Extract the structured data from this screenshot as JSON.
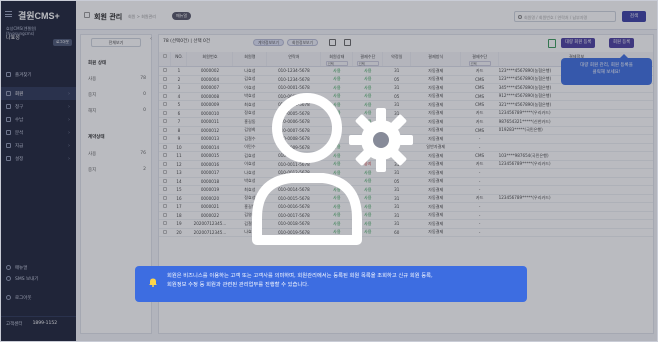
{
  "sidebar": {
    "logo": "결원CMS+",
    "user": {
      "line1": "효성CMS(엔젤원)",
      "line2": "(hyosungcms)",
      "name": "나효성"
    },
    "logout_label": "로그아웃",
    "nav": [
      {
        "label": "즐겨찾기",
        "icon": "star-icon"
      },
      {
        "label": "회원",
        "icon": "user-icon",
        "active": true
      },
      {
        "label": "청구",
        "icon": "bill-icon"
      },
      {
        "label": "수납",
        "icon": "payment-icon"
      },
      {
        "label": "분석",
        "icon": "chart-icon"
      },
      {
        "label": "지급",
        "icon": "send-icon"
      },
      {
        "label": "설정",
        "icon": "gear-icon"
      }
    ],
    "bottom": [
      {
        "label": "매뉴얼",
        "icon": "book-icon"
      },
      {
        "label": "SMS 보내기",
        "icon": "sms-icon"
      },
      {
        "label": "로그아웃",
        "icon": "logout-icon"
      }
    ],
    "contact": {
      "label": "고객센터",
      "number": "1899-1152"
    }
  },
  "topbar": {
    "title": "회원 관리",
    "breadcrumb": "회원 > 회원관리",
    "badge": "매뉴얼",
    "search_placeholder": "회원명 / 회원번호 / 연락처 / 납부자명",
    "search_button": "검색"
  },
  "filter": {
    "button": "전체보기",
    "sections": [
      {
        "title": "회원 상태",
        "rows": [
          {
            "label": "사용",
            "count": "78"
          },
          {
            "label": "중지",
            "count": "0"
          },
          {
            "label": "해지",
            "count": "0"
          }
        ]
      },
      {
        "title": "계약상태",
        "rows": [
          {
            "label": "사용",
            "count": "76"
          },
          {
            "label": "중지",
            "count": "2"
          }
        ]
      }
    ]
  },
  "grid": {
    "total": "78",
    "selected": "선택 0건",
    "count_text": "78 (선택0건) | 선택 0건",
    "chips": [
      "계약정보보기",
      "회원정보보기"
    ],
    "register_bulk": "대량 회원 등록",
    "register_one": "회원 등록",
    "columns": [
      "",
      "NO.",
      "회원번호",
      "회원명",
      "연락처",
      "회원상태",
      "결제수단",
      "약정일",
      "결제방식",
      "결제수단",
      "결제정보"
    ],
    "sub_labels": {
      "c5": "선택",
      "c6": "선택",
      "c9": "선택"
    },
    "rows": [
      [
        "1",
        "0000002",
        "나효성",
        "010-1234-5678",
        "사용",
        "사용",
        "31",
        "자동결제",
        "카드",
        "123****4567890(농협은행)"
      ],
      [
        "2",
        "0000004",
        "김효성",
        "010-1234-5678",
        "사용",
        "사용",
        "05",
        "자동결제",
        "CMS",
        "123****4567890(농협은행)"
      ],
      [
        "3",
        "0000007",
        "이효성",
        "010-0001-5678",
        "사용",
        "사용",
        "31",
        "자동결제",
        "CMS",
        "345****4567890(농협은행)"
      ],
      [
        "4",
        "0000008",
        "박효성",
        "010-0002-5678",
        "사용",
        "사용",
        "05",
        "자동결제",
        "CMS",
        "912****4567890(농협은행)"
      ],
      [
        "5",
        "0000009",
        "최효성",
        "010-0004-5678",
        "사용",
        "사용",
        "31",
        "자동결제",
        "CMS",
        "321****4567890(농협은행)"
      ],
      [
        "6",
        "0000010",
        "정효성",
        "010-0005-5678",
        "사용",
        "사용",
        "31",
        "자동결제",
        "카드",
        "123456789*****(우리카드)"
      ],
      [
        "7",
        "0000011",
        "홍길동",
        "010-0006-5678",
        "사용",
        "사용",
        "31",
        "자동결제",
        "카드",
        "987654321*****(신한카드)"
      ],
      [
        "8",
        "0000012",
        "김영희",
        "010-0007-5678",
        "사용",
        "사용",
        "31",
        "자동결제",
        "CMS",
        "019283*****(국민은행)"
      ],
      [
        "9",
        "0000013",
        "김철수",
        "010-0008-5678",
        "사용",
        "중지",
        "31",
        "자동결제",
        "-",
        ""
      ],
      [
        "10",
        "0000014",
        "이민수",
        "010-0009-5678",
        "사용",
        "사용",
        "31",
        "일반자결제",
        "-",
        ""
      ],
      [
        "11",
        "0000015",
        "김효성",
        "010-0010-5678",
        "사용",
        "사용",
        "05",
        "자동결제",
        "CMS",
        "103****987654(국민은행)"
      ],
      [
        "12",
        "0000016",
        "이효성",
        "010-0011-5678",
        "사용",
        "중지",
        "31",
        "자동결제",
        "카드",
        "123456789*****(우리카드)"
      ],
      [
        "13",
        "0000017",
        "나효성",
        "010-0012-5678",
        "사용",
        "사용",
        "31",
        "자동결제",
        "-",
        ""
      ],
      [
        "14",
        "0000018",
        "박효성",
        "010-0013-5678",
        "사용",
        "사용",
        "05",
        "자동결제",
        "-",
        ""
      ],
      [
        "15",
        "0000019",
        "최효성",
        "010-0014-5678",
        "사용",
        "사용",
        "31",
        "자동결제",
        "-",
        ""
      ],
      [
        "16",
        "0000020",
        "정효성",
        "010-0015-5678",
        "사용",
        "사용",
        "31",
        "자동결제",
        "카드",
        "123456789*****(우리카드)"
      ],
      [
        "17",
        "0000021",
        "홍길동",
        "010-0016-5678",
        "사용",
        "사용",
        "31",
        "자동결제",
        "-",
        ""
      ],
      [
        "18",
        "0000022",
        "김영희",
        "010-0017-5678",
        "사용",
        "사용",
        "31",
        "자동결제",
        "-",
        ""
      ],
      [
        "19",
        "20200712345...",
        "김철수",
        "010-0018-5678",
        "사용",
        "사용",
        "31",
        "자동결제",
        "-",
        ""
      ],
      [
        "20",
        "20200712345...",
        "나효성",
        "010-0019-5678",
        "사용",
        "사용",
        "60",
        "자동결제",
        "-",
        ""
      ]
    ]
  },
  "tooltip": {
    "line1": "대량 회원 관리, 회원 등록을",
    "line2": "클릭해 보세요!"
  },
  "banner": {
    "line1": "회원은 비즈니스를 이용하는 고객 또는 고객사를 의미하며, 회원관리에서는 등록된 회원 목록을 조회하고 신규 회원 등록,",
    "line2": "회원정보 수정 등 회원과 관련된 관리업무를 진행할 수 있습니다."
  },
  "colors": {
    "primary": "#3a3fa6",
    "banner": "#3d6de1",
    "sidebar": "#1c2238",
    "green": "#2a9d4c",
    "red": "#d13b3b"
  }
}
